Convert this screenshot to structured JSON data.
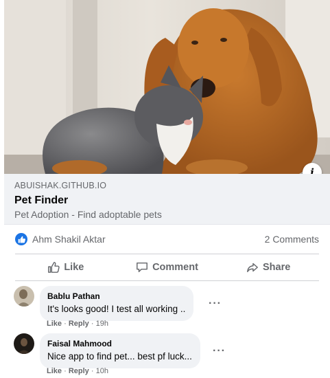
{
  "post": {
    "link": {
      "domain": "ABUISHAK.GITHUB.IO",
      "title": "Pet Finder",
      "subtitle": "Pet Adoption - Find adoptable pets",
      "info_icon": "i"
    },
    "reactions": {
      "icon": "thumbs-up-icon",
      "reactor_name": "Ahm Shakil Aktar"
    },
    "comment_count": "2 Comments",
    "actions": {
      "like": "Like",
      "comment": "Comment",
      "share": "Share"
    },
    "comments": [
      {
        "author": "Bablu Pathan",
        "text": "It's looks good! I test all working ..",
        "footer": {
          "like": "Like",
          "reply": "Reply",
          "time": "19h",
          "separator": "·"
        },
        "more": "···"
      },
      {
        "author": "Faisal Mahmood",
        "text": "Nice app to find pet... best pf luck...",
        "footer": {
          "like": "Like",
          "reply": "Reply",
          "time": "10h",
          "separator": "·"
        },
        "more": "···"
      }
    ]
  },
  "colors": {
    "accent": "#1b74e4",
    "muted_text": "#65676b",
    "bubble": "#f0f2f5"
  }
}
